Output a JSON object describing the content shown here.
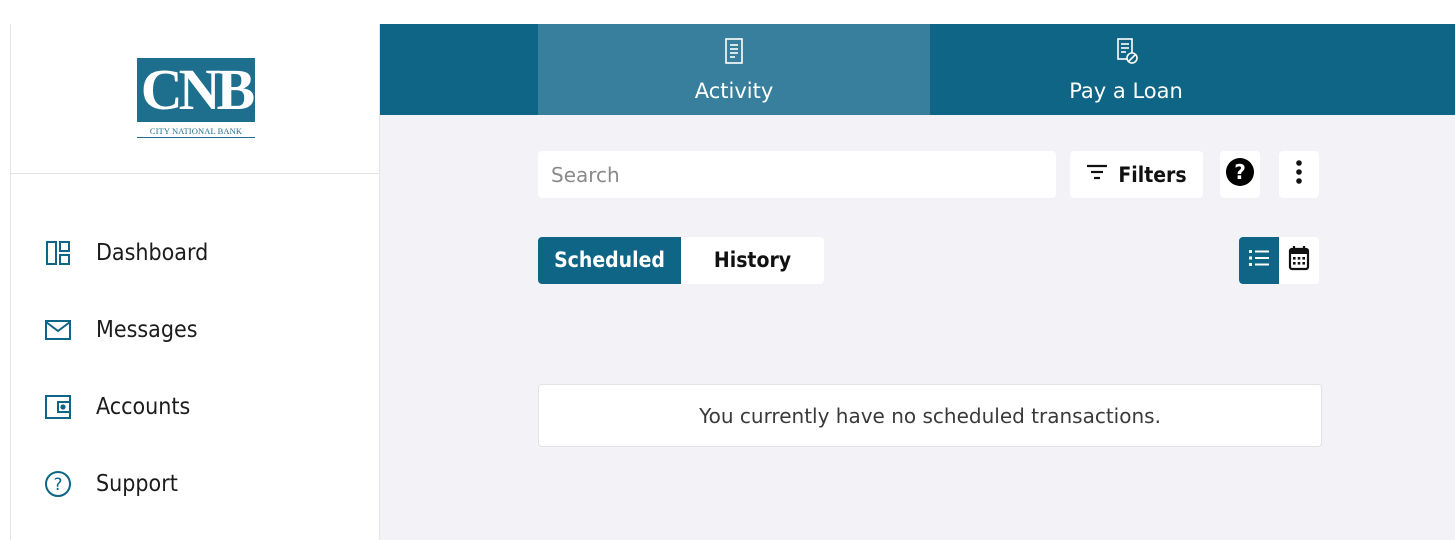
{
  "brand": {
    "logo_letters": "CNB",
    "logo_subtitle": "CITY NATIONAL BANK",
    "color": "#1e6f8e"
  },
  "theme": {
    "primary": "#0f6585",
    "primary_active_tab": "#377f9c",
    "background": "#f3f3f7"
  },
  "sidebar": {
    "items": [
      {
        "label": "Dashboard",
        "icon": "dashboard-icon"
      },
      {
        "label": "Messages",
        "icon": "envelope-icon"
      },
      {
        "label": "Accounts",
        "icon": "wallet-icon"
      },
      {
        "label": "Support",
        "icon": "question-circle-icon"
      }
    ]
  },
  "tabs": [
    {
      "label": "Activity",
      "icon": "receipt-icon",
      "active": true
    },
    {
      "label": "Pay a Loan",
      "icon": "loan-document-icon",
      "active": false
    }
  ],
  "toolbar": {
    "search_placeholder": "Search",
    "search_value": "",
    "filters_label": "Filters"
  },
  "segmented": {
    "options": [
      {
        "label": "Scheduled",
        "selected": true
      },
      {
        "label": "History",
        "selected": false
      }
    ]
  },
  "view_modes": [
    {
      "icon": "list-icon",
      "selected": true
    },
    {
      "icon": "calendar-icon",
      "selected": false
    }
  ],
  "empty_state": {
    "message": "You currently have no scheduled transactions."
  }
}
